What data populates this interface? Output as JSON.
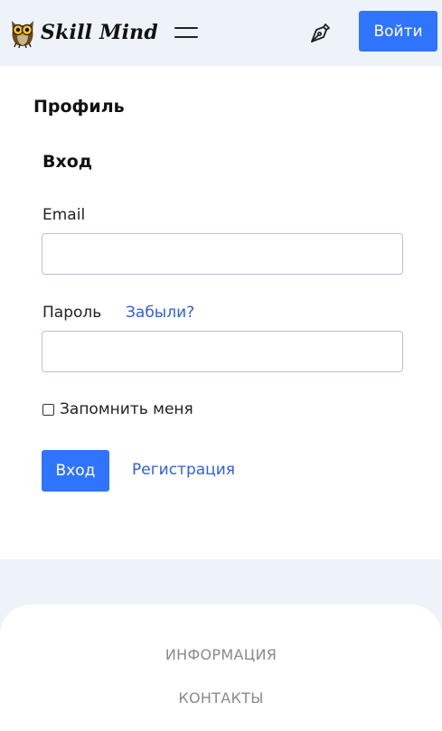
{
  "header": {
    "logo_text": "Skill Mind",
    "login_button": "Войти",
    "icons": {
      "logo": "owl-icon",
      "menu": "hamburger-menu-icon",
      "write": "pen-nib-icon"
    }
  },
  "page": {
    "title": "Профиль"
  },
  "login_form": {
    "title": "Вход",
    "email_label": "Email",
    "email_value": "",
    "password_label": "Пароль",
    "password_value": "",
    "forgot_link": "Забыли?",
    "remember_label": "Запомнить меня",
    "remember_checked": false,
    "submit_button": "Вход",
    "register_link": "Регистрация"
  },
  "footer": {
    "links": [
      "ИНФОРМАЦИЯ",
      "КОНТАКТЫ"
    ]
  },
  "colors": {
    "accent": "#2f74ff",
    "link": "#2f5fe0",
    "header_bg": "#eef2f9",
    "footer_text": "#8a8a8a"
  }
}
